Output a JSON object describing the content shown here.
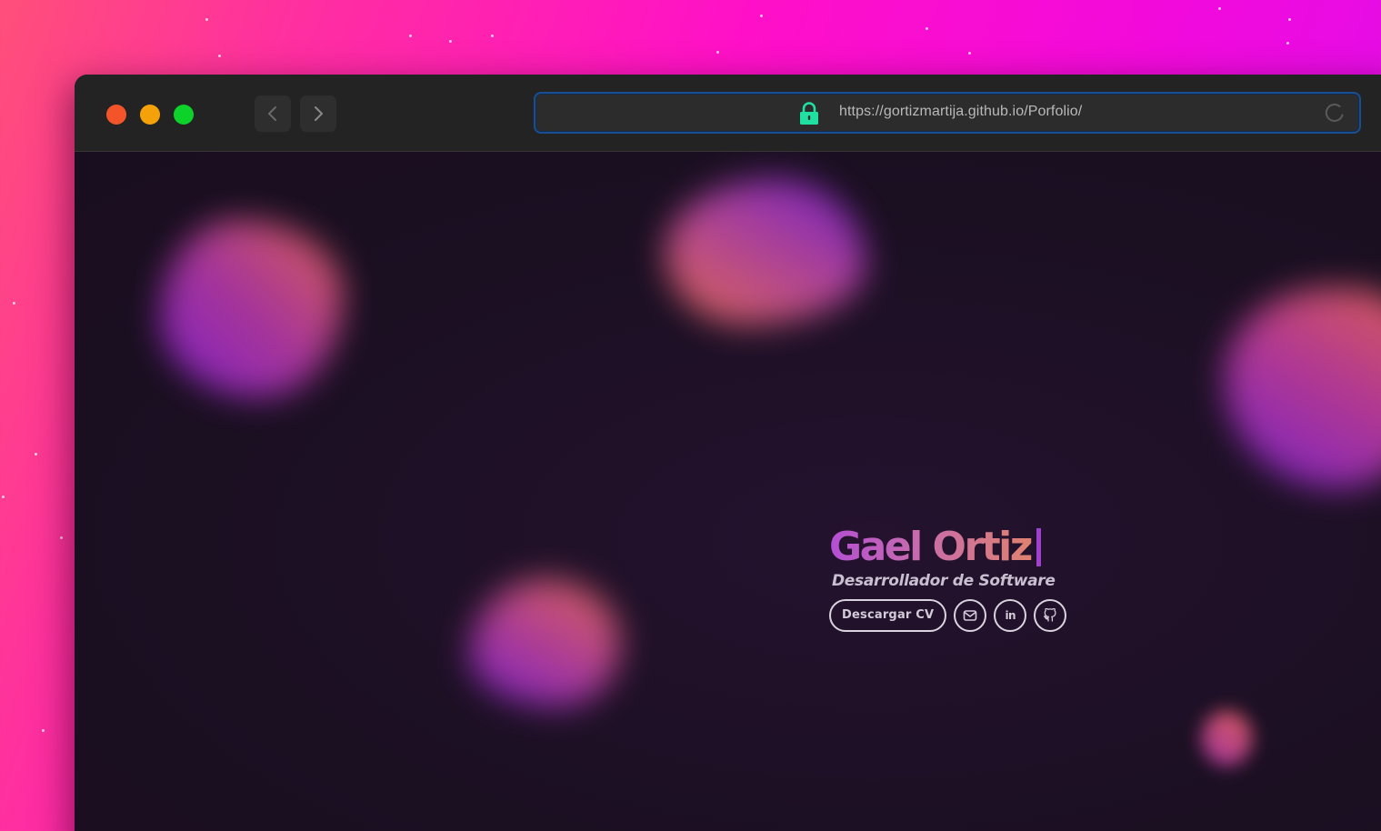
{
  "browser": {
    "url": "https://gortizmartija.github.io/Porfolio/",
    "back_icon": "chevron-left-icon",
    "forward_icon": "chevron-right-icon",
    "secure_icon": "lock-icon",
    "reload_icon": "reload-icon"
  },
  "hero": {
    "name": "Gael Ortiz",
    "subtitle": "Desarrollador de Software",
    "download_cv_label": "Descargar CV",
    "email_icon": "mail-icon",
    "linkedin_label": "in",
    "linkedin_icon": "linkedin-icon",
    "github_icon": "github-icon"
  },
  "colors": {
    "accent_gradient_start": "#b44fd3",
    "accent_gradient_end": "#e0826e",
    "page_background": "#1b0f22",
    "lock": "#1fe0a0",
    "traffic_close": "#f4542a",
    "traffic_minimize": "#f5a20a",
    "traffic_maximize": "#0cd22a"
  }
}
